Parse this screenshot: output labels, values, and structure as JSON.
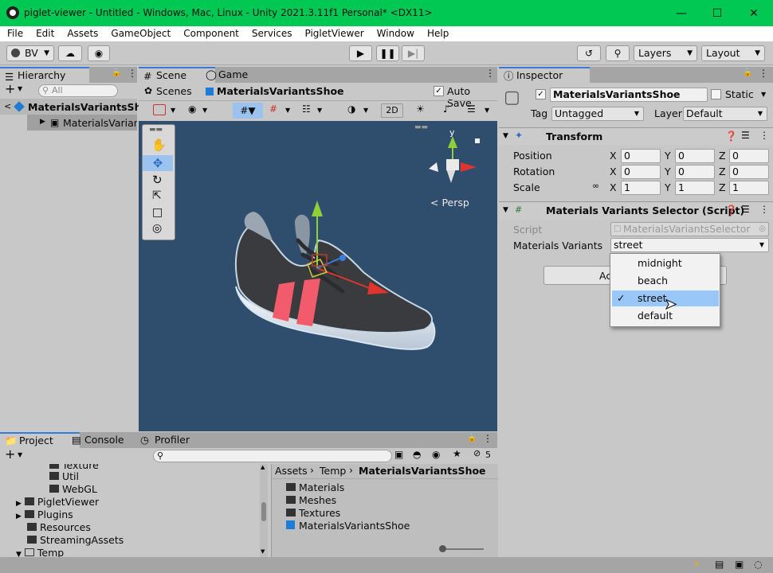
{
  "window": {
    "title": "piglet-viewer - Untitled - Windows, Mac, Linux - Unity 2021.3.11f1 Personal* <DX11>",
    "title_bar_color": "#00c853"
  },
  "menu": [
    "File",
    "Edit",
    "Assets",
    "GameObject",
    "Component",
    "Services",
    "PigletViewer",
    "Window",
    "Help"
  ],
  "toolbar": {
    "account": "BV",
    "layers": "Layers",
    "layout": "Layout"
  },
  "hierarchy": {
    "tab": "Hierarchy",
    "search_placeholder": "All",
    "root": "MaterialsVariantsShoe",
    "child": "MaterialsVariant"
  },
  "scene": {
    "tabs": [
      "Scene",
      "Game"
    ],
    "breadcrumb": "Scenes",
    "object": "MaterialsVariantsShoe",
    "auto_save": "Auto Save",
    "mode_2d": "2D",
    "persp": "< Persp",
    "gizmo_y": "y"
  },
  "inspector": {
    "tab": "Inspector",
    "object_name": "MaterialsVariantsShoe",
    "static_label": "Static",
    "tag_label": "Tag",
    "tag_value": "Untagged",
    "layer_label": "Layer",
    "layer_value": "Default",
    "transform": {
      "title": "Transform",
      "rows": [
        {
          "label": "Position",
          "x": "0",
          "y": "0",
          "z": "0"
        },
        {
          "label": "Rotation",
          "x": "0",
          "y": "0",
          "z": "0"
        },
        {
          "label": "Scale",
          "x": "1",
          "y": "1",
          "z": "1"
        }
      ],
      "axis": [
        "X",
        "Y",
        "Z"
      ]
    },
    "selector": {
      "title": "Materials Variants Selector (Script)",
      "script_label": "Script",
      "script_value": "MaterialsVariantsSelector",
      "variants_label": "Materials Variants",
      "variants_value": "street",
      "button_partial": "Ac"
    },
    "options": [
      "midnight",
      "beach",
      "street",
      "default"
    ],
    "selected": "street"
  },
  "bottom": {
    "tabs": [
      "Project",
      "Console",
      "Profiler"
    ],
    "badge": "5",
    "tree": [
      "Texture",
      "Util",
      "WebGL",
      "PigletViewer",
      "Plugins",
      "Resources",
      "StreamingAssets",
      "Temp"
    ],
    "path": [
      "Assets",
      "Temp",
      "MaterialsVariantsShoe"
    ],
    "files": [
      "Materials",
      "Meshes",
      "Textures",
      "MaterialsVariantsShoe"
    ]
  }
}
